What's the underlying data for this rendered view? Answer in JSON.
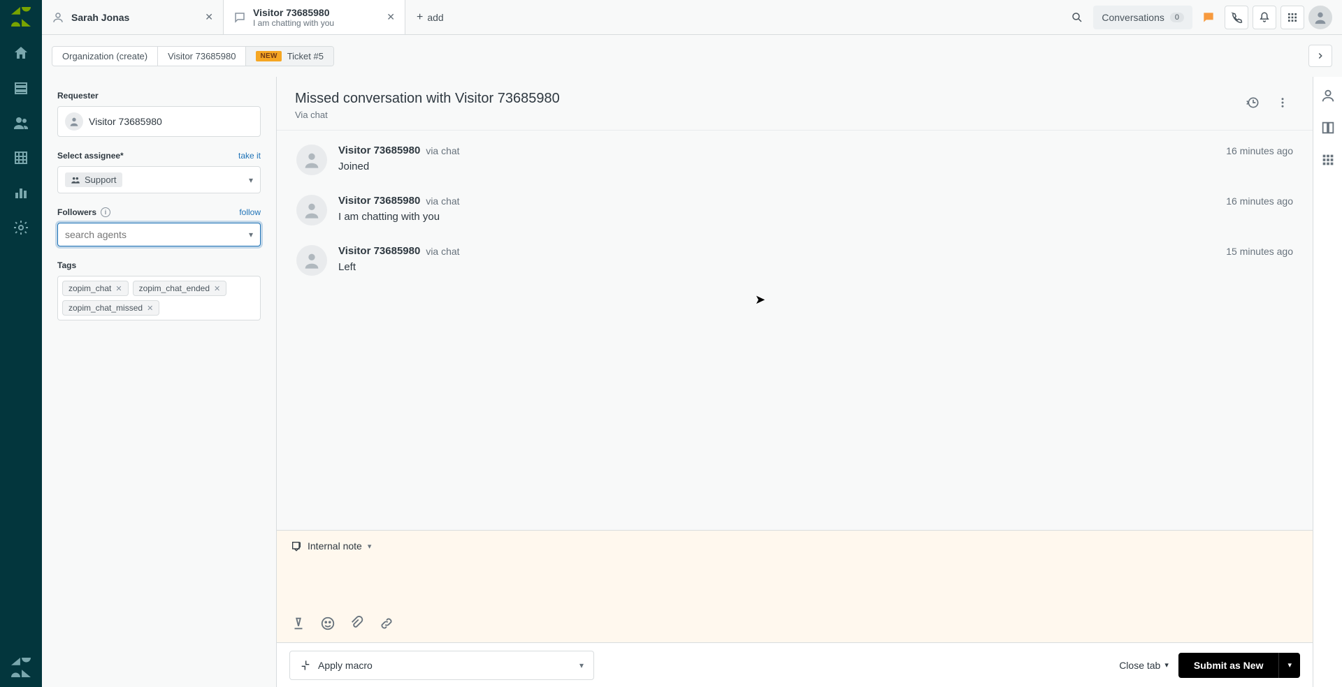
{
  "tabs": [
    {
      "title": "Sarah Jonas",
      "subtitle": ""
    },
    {
      "title": "Visitor 73685980",
      "subtitle": "I am chatting with you"
    }
  ],
  "add_tab_label": "add",
  "conversations_label": "Conversations",
  "conversations_count": "0",
  "breadcrumb": {
    "org": "Organization (create)",
    "visitor": "Visitor 73685980",
    "new_label": "NEW",
    "ticket": "Ticket #5"
  },
  "sidebar": {
    "requester_label": "Requester",
    "requester_value": "Visitor 73685980",
    "assignee_label": "Select assignee*",
    "take_it": "take it",
    "assignee_value": "Support",
    "followers_label": "Followers",
    "follow": "follow",
    "followers_placeholder": "search agents",
    "tags_label": "Tags",
    "tags": [
      "zopim_chat",
      "zopim_chat_ended",
      "zopim_chat_missed"
    ]
  },
  "conversation": {
    "title": "Missed conversation with Visitor 73685980",
    "subtitle": "Via chat",
    "messages": [
      {
        "name": "Visitor 73685980",
        "via": "via chat",
        "time": "16 minutes ago",
        "text": "Joined"
      },
      {
        "name": "Visitor 73685980",
        "via": "via chat",
        "time": "16 minutes ago",
        "text": "I am chatting with you"
      },
      {
        "name": "Visitor 73685980",
        "via": "via chat",
        "time": "15 minutes ago",
        "text": "Left"
      }
    ]
  },
  "composer": {
    "mode": "Internal note"
  },
  "footer": {
    "macro": "Apply macro",
    "close_tab": "Close tab",
    "submit": "Submit as New"
  }
}
